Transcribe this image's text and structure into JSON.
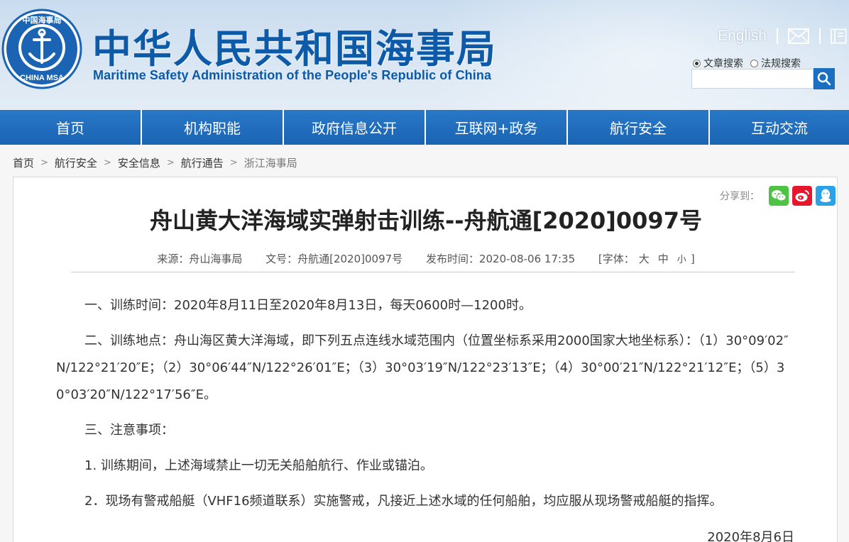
{
  "header": {
    "title_cn": "中华人民共和国海事局",
    "title_en": "Maritime Safety Administration of the People's Republic of China",
    "logo_text_top": "中国海事局",
    "logo_text_bottom": "CHINA MSA",
    "english_label": "English",
    "search_options": [
      "文章搜索",
      "法规搜索"
    ],
    "search_value": ""
  },
  "nav": [
    "首页",
    "机构职能",
    "政府信息公开",
    "互联网+政务",
    "航行安全",
    "互动交流"
  ],
  "breadcrumb": [
    "首页",
    "航行安全",
    "安全信息",
    "航行通告",
    "浙江海事局"
  ],
  "share_label": "分享到：",
  "article": {
    "title": "舟山黄大洋海域实弹射击训练--舟航通[2020]0097号",
    "source": "来源：舟山海事局",
    "doc_no": "文号：舟航通[2020]0097号",
    "publish_time": "发布时间：2020-08-06 17:35",
    "font_label": "[字体：",
    "font_big": "大",
    "font_mid": "中",
    "font_small": "小",
    "font_close": "]",
    "paragraphs": [
      "一、训练时间：2020年8月11日至2020年8月13日，每天0600时—1200时。",
      "二、训练地点：舟山海区黄大洋海域，即下列五点连线水域范围内（位置坐标系采用2000国家大地坐标系）：（1）30°09′02″N/122°21′20″E；（2）30°06′44″N/122°26′01″E；（3）30°03′19″N/122°23′13″E；（4）30°00′21″N/122°21′12″E；（5）30°03′20″N/122°17′56″E。",
      "三、注意事项：",
      "1. 训练期间，上述海域禁止一切无关船舶航行、作业或锚泊。",
      "2．现场有警戒船艇（VHF16频道联系）实施警戒，凡接近上述水域的任何船舶，均应服从现场警戒船艇的指挥。"
    ],
    "date": "2020年8月6日"
  },
  "colors": {
    "brand_blue": "#0d5aa8",
    "nav_blue": "#1d6cbd"
  }
}
